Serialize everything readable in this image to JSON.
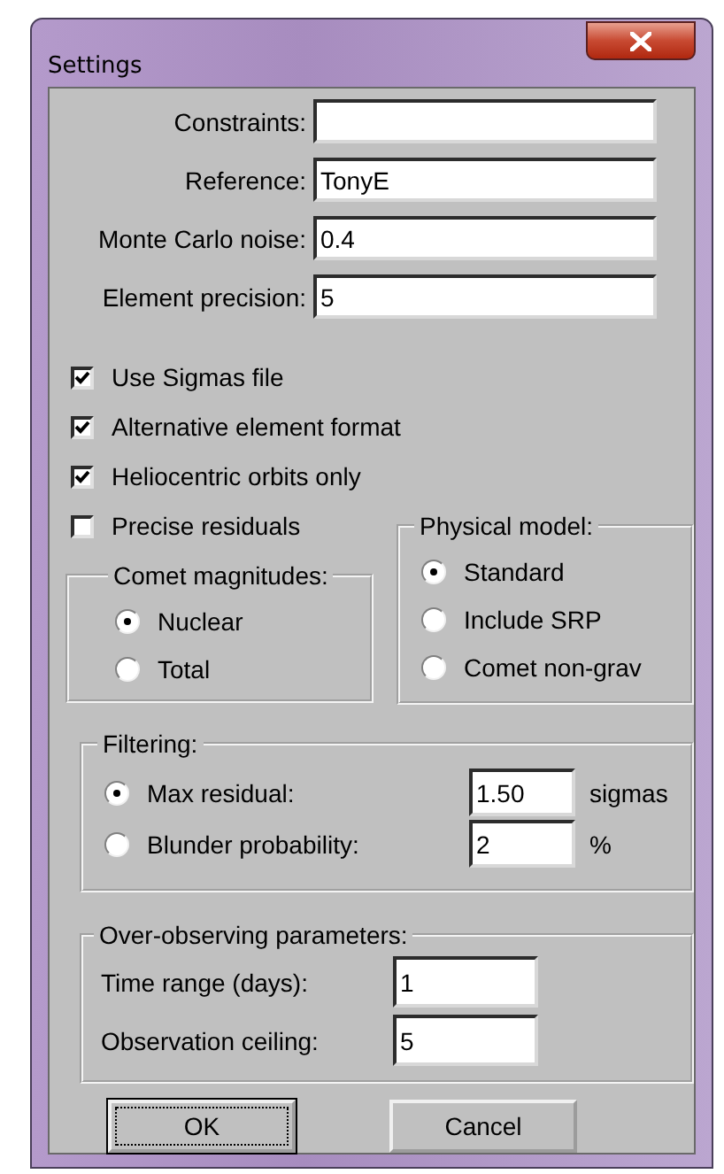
{
  "window": {
    "title": "Settings"
  },
  "fields": [
    {
      "label": "Constraints:"
    },
    {
      "label": "Reference:",
      "value": "TonyE"
    },
    {
      "label": "Monte Carlo noise:",
      "value": "0.4"
    },
    {
      "label": "Element precision:",
      "value": "5"
    }
  ],
  "checkboxes": [
    {
      "label": "Use Sigmas file",
      "checked": true
    },
    {
      "label": "Alternative element format",
      "checked": true
    },
    {
      "label": "Heliocentric orbits only",
      "checked": true
    },
    {
      "label": "Precise residuals",
      "checked": false
    }
  ],
  "comet_magnitudes": {
    "title": "Comet magnitudes:",
    "options": [
      {
        "label": "Nuclear",
        "selected": true
      },
      {
        "label": "Total",
        "selected": false
      }
    ]
  },
  "physical_model": {
    "title": "Physical model:",
    "options": [
      {
        "label": "Standard",
        "selected": true
      },
      {
        "label": "Include SRP",
        "selected": false
      },
      {
        "label": "Comet non-grav",
        "selected": false
      }
    ]
  },
  "filtering": {
    "title": "Filtering:",
    "options": [
      {
        "label": "Max residual:",
        "selected": true,
        "value": "1.50",
        "unit": "sigmas"
      },
      {
        "label": "Blunder probability:",
        "selected": false,
        "value": "2",
        "unit": "%"
      }
    ]
  },
  "over_observing": {
    "title": "Over-observing parameters:",
    "fields": [
      {
        "label": "Time range (days):",
        "value": "1"
      },
      {
        "label": "Observation ceiling:",
        "value": "5"
      }
    ]
  },
  "buttons": [
    {
      "label": "OK",
      "focused": true
    },
    {
      "label": "Cancel",
      "focused": false
    }
  ]
}
